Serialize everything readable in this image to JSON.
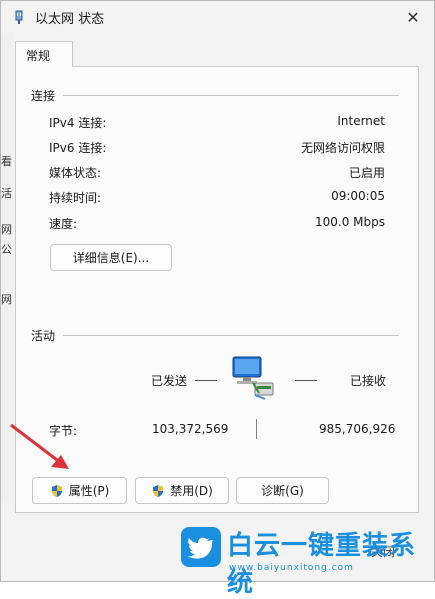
{
  "window": {
    "title": "以太网 状态",
    "close_glyph": "✕"
  },
  "tab": {
    "label": "常规"
  },
  "connection": {
    "title": "连接",
    "rows": [
      {
        "label": "IPv4 连接:",
        "value": "Internet"
      },
      {
        "label": "IPv6 连接:",
        "value": "无网络访问权限"
      },
      {
        "label": "媒体状态:",
        "value": "已启用"
      },
      {
        "label": "持续时间:",
        "value": "09:00:05"
      },
      {
        "label": "速度:",
        "value": "100.0 Mbps"
      }
    ],
    "details_button": "详细信息(E)..."
  },
  "activity": {
    "title": "活动",
    "sent_label": "已发送",
    "received_label": "已接收",
    "bytes_label": "字节:",
    "bytes_sent": "103,372,569",
    "bytes_received": "985,706,926"
  },
  "buttons": {
    "properties": "属性(P)",
    "disable": "禁用(D)",
    "diagnose": "诊断(G)",
    "close_partial": "关闭"
  },
  "background_strip": [
    "看",
    "活",
    "网",
    "公",
    "网"
  ],
  "watermark": {
    "text": "白云一键重装系统",
    "url": "www.baiyunxitong.com"
  },
  "colors": {
    "accent": "#1a8fe0",
    "arrow": "#e0313a",
    "shield_blue": "#1f6fd1",
    "shield_yellow": "#f2c12e"
  },
  "icons": {
    "network": "network-computer-icon",
    "shield": "uac-shield-icon",
    "title": "network-adapter-icon"
  }
}
